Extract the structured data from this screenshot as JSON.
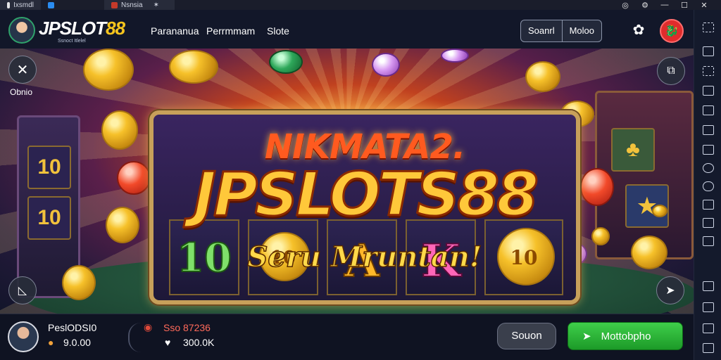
{
  "browser": {
    "tabs": [
      {
        "label": "Ixsmdl",
        "favicon_color": "#e6e6e6"
      },
      {
        "label": "",
        "favicon_color": "#2a8cf0"
      },
      {
        "label": "Nsnsia",
        "favicon_color": "#c43a2a"
      }
    ],
    "window_controls": [
      "◎",
      "⚙",
      "—",
      "☐",
      "✕"
    ]
  },
  "header": {
    "logo_main": "JPSLOT",
    "logo_digits": "88",
    "logo_sub": "Ssnoct Itlelel",
    "nav": [
      "Parananua",
      "Perrmmam",
      "Slote"
    ],
    "buttons": {
      "left": "Soanrl",
      "right": "Moloo"
    },
    "gear_icon": "gear-icon",
    "profile_icon": "dragon-badge-icon"
  },
  "banner": {
    "line1": "NIKMATA2.",
    "line2": "JPSLOTS88",
    "line3": "Seru Mruntan!",
    "reels": [
      "10",
      "10",
      "A",
      "K",
      "10"
    ],
    "close_label": "Obnio",
    "colors": {
      "orange": "#ff5a1f",
      "gold": "#ffc83a",
      "frame": "#c7a05a"
    }
  },
  "footer": {
    "user_name": "PeslODSI0",
    "user_balance": "9.0.00",
    "stat_top": "Sso 87236",
    "stat_bottom": "300.0K",
    "search_label": "Souon",
    "main_label": "Mottobpho",
    "accent": "#3fcf4a"
  }
}
